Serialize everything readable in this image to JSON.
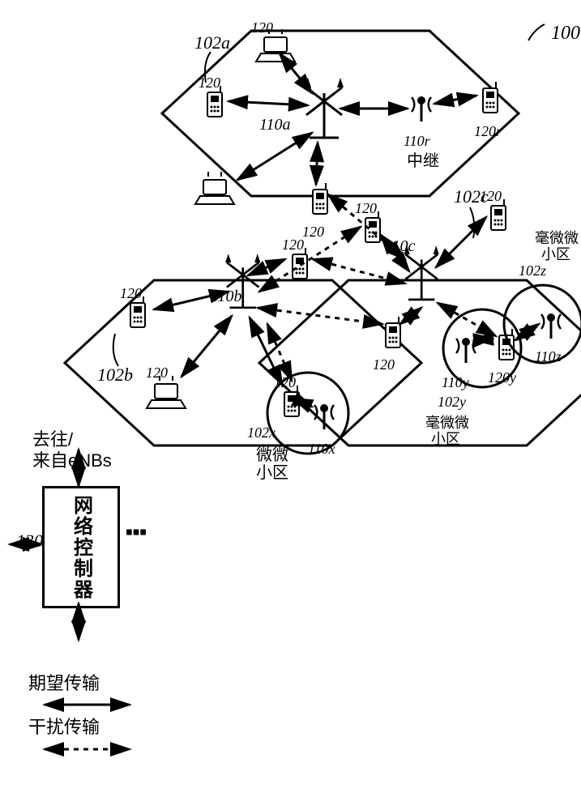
{
  "figure_id": "100",
  "legend": {
    "network_controller": "网络控制器",
    "nc_ref": "130",
    "nc_arrows_label": "去往/\n来自eNBs",
    "desired": "期望传输",
    "interference": "干扰传输"
  },
  "cells": {
    "a": {
      "label_cell": "102a",
      "enb": "110a"
    },
    "b": {
      "label_cell": "102b",
      "enb": "110b"
    },
    "c": {
      "label_cell": "102c",
      "enb": "110c"
    }
  },
  "small_cells": {
    "pico": {
      "cell": "102x",
      "enb": "110x",
      "name": "微微\n小区"
    },
    "femto1": {
      "cell": "102y",
      "enb": "110y",
      "ue": "120y",
      "name": "毫微微\n小区"
    },
    "femto2": {
      "cell": "102z",
      "enb": "110z",
      "name": "毫微微\n小区"
    }
  },
  "relay": {
    "enb": "110r",
    "ue": "120r",
    "name": "中继"
  },
  "ue_label": "120"
}
